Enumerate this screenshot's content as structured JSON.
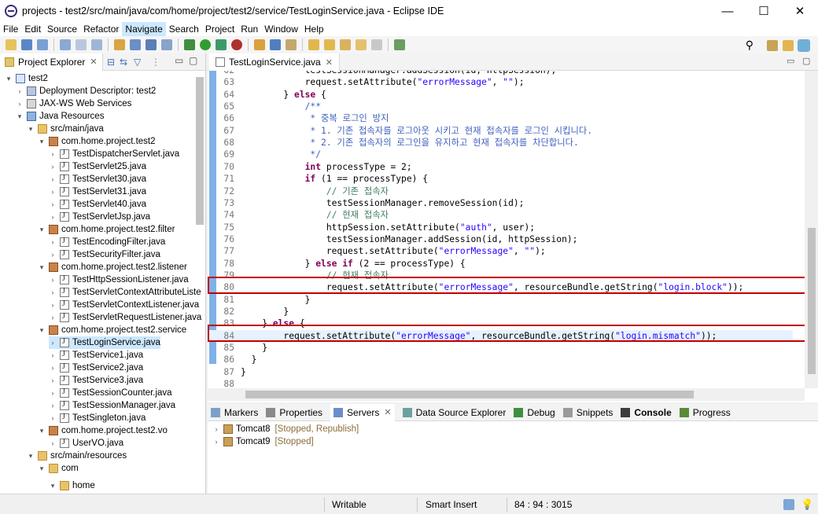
{
  "window": {
    "title": "projects - test2/src/main/java/com/home/project/test2/service/TestLoginService.java - Eclipse IDE",
    "minimize": "—",
    "maximize": "☐",
    "close": "✕"
  },
  "menu": [
    "File",
    "Edit",
    "Source",
    "Refactor",
    "Navigate",
    "Search",
    "Project",
    "Run",
    "Window",
    "Help"
  ],
  "menu_active": "Navigate",
  "project_explorer": {
    "tab_label": "Project Explorer",
    "close": "✕",
    "tree": [
      {
        "label": "test2",
        "arrow": "▾",
        "type": "proj",
        "indent": 0
      },
      {
        "label": "Deployment Descriptor: test2",
        "arrow": "›",
        "type": "desc",
        "indent": 1
      },
      {
        "label": "JAX-WS Web Services",
        "arrow": "›",
        "type": "ws",
        "indent": 1
      },
      {
        "label": "Java Resources",
        "arrow": "▾",
        "type": "jr",
        "indent": 1
      },
      {
        "label": "src/main/java",
        "arrow": "▾",
        "type": "folder",
        "indent": 2
      },
      {
        "label": "com.home.project.test2",
        "arrow": "▾",
        "type": "pkg",
        "indent": 3
      },
      {
        "label": "TestDispatcherServlet.java",
        "arrow": "›",
        "type": "java",
        "indent": 4
      },
      {
        "label": "TestServlet25.java",
        "arrow": "›",
        "type": "java",
        "indent": 4
      },
      {
        "label": "TestServlet30.java",
        "arrow": "›",
        "type": "java",
        "indent": 4
      },
      {
        "label": "TestServlet31.java",
        "arrow": "›",
        "type": "java",
        "indent": 4
      },
      {
        "label": "TestServlet40.java",
        "arrow": "›",
        "type": "java",
        "indent": 4
      },
      {
        "label": "TestServletJsp.java",
        "arrow": "›",
        "type": "java",
        "indent": 4
      },
      {
        "label": "com.home.project.test2.filter",
        "arrow": "▾",
        "type": "pkg",
        "indent": 3
      },
      {
        "label": "TestEncodingFilter.java",
        "arrow": "›",
        "type": "java",
        "indent": 4
      },
      {
        "label": "TestSecurityFilter.java",
        "arrow": "›",
        "type": "java",
        "indent": 4
      },
      {
        "label": "com.home.project.test2.listener",
        "arrow": "▾",
        "type": "pkg",
        "indent": 3
      },
      {
        "label": "TestHttpSessionListener.java",
        "arrow": "›",
        "type": "java",
        "indent": 4
      },
      {
        "label": "TestServletContextAttributeListe",
        "arrow": "›",
        "type": "java",
        "indent": 4
      },
      {
        "label": "TestServletContextListener.java",
        "arrow": "›",
        "type": "java",
        "indent": 4
      },
      {
        "label": "TestServletRequestListener.java",
        "arrow": "›",
        "type": "java",
        "indent": 4
      },
      {
        "label": "com.home.project.test2.service",
        "arrow": "▾",
        "type": "pkg",
        "indent": 3
      },
      {
        "label": "TestLoginService.java",
        "arrow": "›",
        "type": "java",
        "indent": 4,
        "selected": true
      },
      {
        "label": "TestService1.java",
        "arrow": "›",
        "type": "java",
        "indent": 4
      },
      {
        "label": "TestService2.java",
        "arrow": "›",
        "type": "java",
        "indent": 4
      },
      {
        "label": "TestService3.java",
        "arrow": "›",
        "type": "java",
        "indent": 4
      },
      {
        "label": "TestSessionCounter.java",
        "arrow": "›",
        "type": "java",
        "indent": 4
      },
      {
        "label": "TestSessionManager.java",
        "arrow": "›",
        "type": "java",
        "indent": 4
      },
      {
        "label": "TestSingleton.java",
        "arrow": "›",
        "type": "java",
        "indent": 4
      },
      {
        "label": "com.home.project.test2.vo",
        "arrow": "▾",
        "type": "pkg",
        "indent": 3
      },
      {
        "label": "UserVO.java",
        "arrow": "›",
        "type": "java",
        "indent": 4
      },
      {
        "label": "src/main/resources",
        "arrow": "▾",
        "type": "folder",
        "indent": 2
      },
      {
        "label": "com",
        "arrow": "▾",
        "type": "folder",
        "indent": 3
      },
      {
        "label": "home",
        "arrow": "▾",
        "type": "folder",
        "indent": 4
      }
    ]
  },
  "editor": {
    "tab_label": "TestLoginService.java",
    "close": "✕",
    "lines": [
      {
        "n": "62",
        "segs": [
          {
            "t": "            testSessionManager.addSession(id, httpSession);",
            "c": ""
          }
        ]
      },
      {
        "n": "63",
        "segs": [
          {
            "t": "            request.setAttribute(",
            "c": ""
          },
          {
            "t": "\"errorMessage\"",
            "c": "str"
          },
          {
            "t": ", ",
            "c": ""
          },
          {
            "t": "\"\"",
            "c": "str"
          },
          {
            "t": ");",
            "c": ""
          }
        ]
      },
      {
        "n": "64",
        "segs": [
          {
            "t": "        } ",
            "c": ""
          },
          {
            "t": "else",
            "c": "kw"
          },
          {
            "t": " {",
            "c": ""
          }
        ]
      },
      {
        "n": "65",
        "segs": [
          {
            "t": "            /**",
            "c": "jdoc"
          }
        ]
      },
      {
        "n": "66",
        "segs": [
          {
            "t": "             * 중복 로그인 방지",
            "c": "jdoc"
          }
        ]
      },
      {
        "n": "67",
        "segs": [
          {
            "t": "             * 1. 기존 접속자를 로그아웃 시키고 현재 접속자를 로그인 시킵니다.",
            "c": "jdoc"
          }
        ]
      },
      {
        "n": "68",
        "segs": [
          {
            "t": "             * 2. 기존 접속자의 로그인을 유지하고 현재 접속자를 차단합니다.",
            "c": "jdoc"
          }
        ]
      },
      {
        "n": "69",
        "segs": [
          {
            "t": "             */",
            "c": "jdoc"
          }
        ]
      },
      {
        "n": "70",
        "segs": [
          {
            "t": "            ",
            "c": ""
          },
          {
            "t": "int",
            "c": "kw"
          },
          {
            "t": " processType = 2;",
            "c": ""
          }
        ]
      },
      {
        "n": "71",
        "segs": [
          {
            "t": "            ",
            "c": ""
          },
          {
            "t": "if",
            "c": "kw"
          },
          {
            "t": " (1 == processType) {",
            "c": ""
          }
        ]
      },
      {
        "n": "72",
        "segs": [
          {
            "t": "                ",
            "c": ""
          },
          {
            "t": "// 기존 접속자",
            "c": "cmt"
          }
        ]
      },
      {
        "n": "73",
        "segs": [
          {
            "t": "                testSessionManager.removeSession(id);",
            "c": ""
          }
        ]
      },
      {
        "n": "74",
        "segs": [
          {
            "t": "                ",
            "c": ""
          },
          {
            "t": "// 현재 접속자",
            "c": "cmt"
          }
        ]
      },
      {
        "n": "75",
        "segs": [
          {
            "t": "                httpSession.setAttribute(",
            "c": ""
          },
          {
            "t": "\"auth\"",
            "c": "str"
          },
          {
            "t": ", user);",
            "c": ""
          }
        ]
      },
      {
        "n": "76",
        "segs": [
          {
            "t": "                testSessionManager.addSession(id, httpSession);",
            "c": ""
          }
        ]
      },
      {
        "n": "77",
        "segs": [
          {
            "t": "                request.setAttribute(",
            "c": ""
          },
          {
            "t": "\"errorMessage\"",
            "c": "str"
          },
          {
            "t": ", ",
            "c": ""
          },
          {
            "t": "\"\"",
            "c": "str"
          },
          {
            "t": ");",
            "c": ""
          }
        ]
      },
      {
        "n": "78",
        "segs": [
          {
            "t": "            } ",
            "c": ""
          },
          {
            "t": "else if",
            "c": "kw"
          },
          {
            "t": " (2 == processType) {",
            "c": ""
          }
        ]
      },
      {
        "n": "79",
        "segs": [
          {
            "t": "                ",
            "c": ""
          },
          {
            "t": "// 현재 접속자",
            "c": "cmt"
          }
        ]
      },
      {
        "n": "80",
        "segs": [
          {
            "t": "                request.setAttribute(",
            "c": ""
          },
          {
            "t": "\"errorMessage\"",
            "c": "str"
          },
          {
            "t": ", resourceBundle.getString(",
            "c": ""
          },
          {
            "t": "\"login.block\"",
            "c": "str"
          },
          {
            "t": "));",
            "c": ""
          }
        ]
      },
      {
        "n": "81",
        "segs": [
          {
            "t": "            }",
            "c": ""
          }
        ]
      },
      {
        "n": "82",
        "segs": [
          {
            "t": "        }",
            "c": ""
          }
        ]
      },
      {
        "n": "83",
        "segs": [
          {
            "t": "    } ",
            "c": ""
          },
          {
            "t": "else",
            "c": "kw"
          },
          {
            "t": " {",
            "c": ""
          }
        ]
      },
      {
        "n": "84",
        "segs": [
          {
            "t": "        request.setAttribute(",
            "c": ""
          },
          {
            "t": "\"errorMessage\"",
            "c": "str"
          },
          {
            "t": ", resourceBundle.getString(",
            "c": ""
          },
          {
            "t": "\"login.mismatch\"",
            "c": "str"
          },
          {
            "t": "));",
            "c": ""
          }
        ],
        "current": true
      },
      {
        "n": "85",
        "segs": [
          {
            "t": "    }",
            "c": ""
          }
        ]
      },
      {
        "n": "86",
        "segs": [
          {
            "t": "  }",
            "c": ""
          }
        ]
      },
      {
        "n": "87",
        "segs": [
          {
            "t": "}",
            "c": ""
          }
        ]
      },
      {
        "n": "88",
        "segs": [
          {
            "t": "",
            "c": ""
          }
        ]
      }
    ]
  },
  "bottom_panel": {
    "tabs": [
      "Markers",
      "Properties",
      "Servers",
      "Data Source Explorer",
      "Debug",
      "Snippets",
      "Console",
      "Progress"
    ],
    "active_tab": "Servers",
    "servers": [
      {
        "name": "Tomcat8",
        "status": "[Stopped, Republish]"
      },
      {
        "name": "Tomcat9",
        "status": "[Stopped]"
      }
    ]
  },
  "status_bar": {
    "writable": "Writable",
    "insert_mode": "Smart Insert",
    "position": "84 : 94 : 3015"
  }
}
